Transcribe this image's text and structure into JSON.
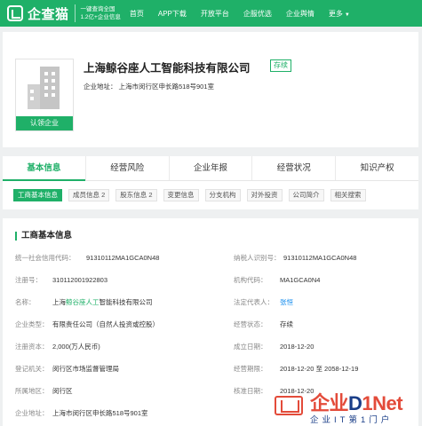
{
  "topbar": {
    "brand": "企查猫",
    "slogan_line1": "一键查询全国",
    "slogan_line2": "1.2亿+企业信息",
    "nav": [
      "首页",
      "APP下载",
      "开放平台",
      "企服优选",
      "企业舆情",
      "更多"
    ],
    "colors": {
      "brand_green": "#1fb068"
    }
  },
  "company": {
    "name": "上海鲸谷座人工智能科技有限公司",
    "status": "存续",
    "address_label": "企业地址：",
    "address": "上海市闵行区申长路518号901室",
    "claim_button": "认领企业"
  },
  "main_tabs": [
    "基本信息",
    "经营风险",
    "企业年报",
    "经营状况",
    "知识产权"
  ],
  "sub_tabs": [
    "工商基本信息",
    "成员信息 2",
    "股东信息 2",
    "变更信息",
    "分支机构",
    "对外投资",
    "公司简介",
    "相关搜索"
  ],
  "info": {
    "section_title": "工商基本信息",
    "rows": [
      {
        "l1": "统一社会信用代码：",
        "v1": "91310112MA1GCA0N48",
        "l2": "纳税人识别号：",
        "v2": "91310112MA1GCA0N48"
      },
      {
        "l1": "注册号：",
        "v1": "310112001922803",
        "l2": "机构代码：",
        "v2": "MA1GCA0N4"
      },
      {
        "l1": "名称：",
        "v1_a": "上海",
        "v1_b": "鲸谷座人工",
        "v1_c": "智能科技有限公司",
        "l2": "法定代表人：",
        "v2": "张恒"
      },
      {
        "l1": "企业类型：",
        "v1": "有限责任公司（自然人投资或控股）",
        "l2": "经营状态：",
        "v2": "存续"
      },
      {
        "l1": "注册资本：",
        "v1": "2,000(万人民币)",
        "l2": "成立日期：",
        "v2": "2018-12-20"
      },
      {
        "l1": "登记机关：",
        "v1": "闵行区市场监督管理局",
        "l2": "经营期限：",
        "v2": "2018-12-20 至 2058-12-19"
      },
      {
        "l1": "所属地区：",
        "v1": "闵行区",
        "l2": "核准日期：",
        "v2": "2018-12-20"
      },
      {
        "l1": "企业地址：",
        "v1": "上海市闵行区申长路518号901室",
        "l2": "",
        "v2": ""
      }
    ]
  },
  "watermark": {
    "title_a": "企业",
    "title_b": "D",
    "title_c": "1Net",
    "subtitle": "企业IT第1门户"
  }
}
